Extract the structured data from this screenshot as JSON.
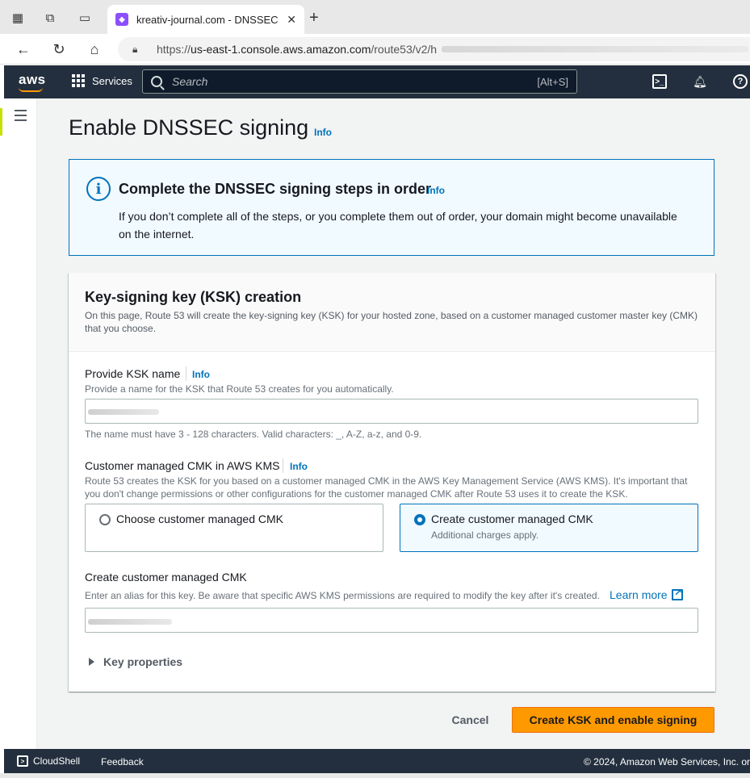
{
  "browser": {
    "tab_title": "kreativ-journal.com - DNSSEC sig",
    "url_prefix": "https://",
    "url_host": "us-east-1.console.aws.amazon.com",
    "url_path": "/route53/v2/h"
  },
  "aws_nav": {
    "logo": "aws",
    "services_label": "Services",
    "search_placeholder": "Search",
    "search_shortcut": "[Alt+S]"
  },
  "page": {
    "title": "Enable DNSSEC signing",
    "info_label": "Info"
  },
  "alert": {
    "title": "Complete the DNSSEC signing steps in order",
    "info_label": "Info",
    "text": "If you don’t complete all of the steps, or you complete them out of order, your domain might become unavailable on the internet."
  },
  "panel": {
    "title": "Key-signing key (KSK) creation",
    "description": "On this page, Route 53 will create the key-signing key (KSK) for your hosted zone, based on a customer managed customer master key (CMK) that you choose."
  },
  "ksk_name": {
    "label": "Provide KSK name",
    "info_label": "Info",
    "description": "Provide a name for the KSK that Route 53 creates for you automatically.",
    "constraint": "The name must have 3 - 128 characters. Valid characters: _, A-Z, a-z, and 0-9."
  },
  "cmk": {
    "label": "Customer managed CMK in AWS KMS",
    "info_label": "Info",
    "description": "Route 53 creates the KSK for you based on a customer managed CMK in the AWS Key Management Service (AWS KMS). It's important that you don't change permissions or other configurations for the customer managed CMK after Route 53 uses it to create the KSK.",
    "option_choose": "Choose customer managed CMK",
    "option_create": "Create customer managed CMK",
    "option_create_sub": "Additional charges apply.",
    "selected": "create"
  },
  "create_cmk": {
    "label": "Create customer managed CMK",
    "description": "Enter an alias for this key. Be aware that specific AWS KMS permissions are required to modify the key after it's created.",
    "learn_more": "Learn more"
  },
  "key_properties": {
    "label": "Key properties"
  },
  "actions": {
    "cancel": "Cancel",
    "submit": "Create KSK and enable signing"
  },
  "footer": {
    "cloudshell": "CloudShell",
    "feedback": "Feedback",
    "copyright": "© 2024, Amazon Web Services, Inc. or"
  },
  "colors": {
    "aws_nav_bg": "#232f3e",
    "primary_button": "#ff9900",
    "link": "#0073bb",
    "alert_bg": "#f1faff"
  }
}
